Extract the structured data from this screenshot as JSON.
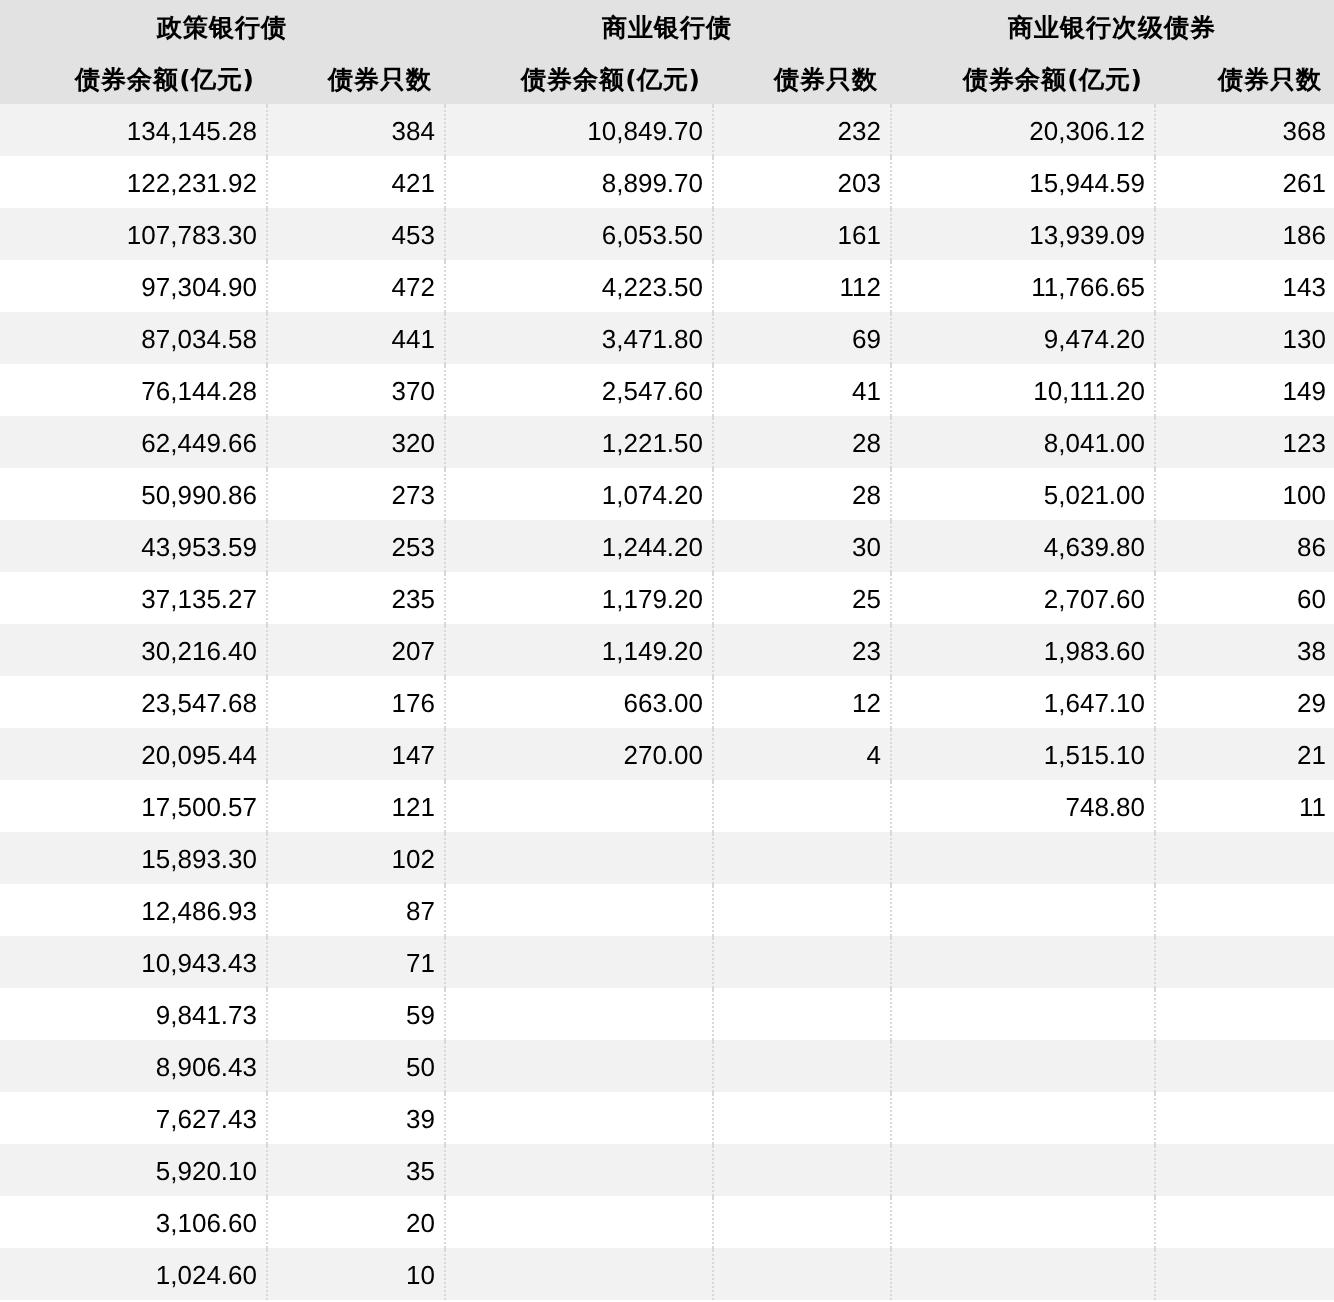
{
  "groups": [
    {
      "title": "政策银行债",
      "columns": [
        "债券余额(亿元)",
        "债券只数"
      ],
      "rows": [
        [
          "134,145.28",
          "384"
        ],
        [
          "122,231.92",
          "421"
        ],
        [
          "107,783.30",
          "453"
        ],
        [
          "97,304.90",
          "472"
        ],
        [
          "87,034.58",
          "441"
        ],
        [
          "76,144.28",
          "370"
        ],
        [
          "62,449.66",
          "320"
        ],
        [
          "50,990.86",
          "273"
        ],
        [
          "43,953.59",
          "253"
        ],
        [
          "37,135.27",
          "235"
        ],
        [
          "30,216.40",
          "207"
        ],
        [
          "23,547.68",
          "176"
        ],
        [
          "20,095.44",
          "147"
        ],
        [
          "17,500.57",
          "121"
        ],
        [
          "15,893.30",
          "102"
        ],
        [
          "12,486.93",
          "87"
        ],
        [
          "10,943.43",
          "71"
        ],
        [
          "9,841.73",
          "59"
        ],
        [
          "8,906.43",
          "50"
        ],
        [
          "7,627.43",
          "39"
        ],
        [
          "5,920.10",
          "35"
        ],
        [
          "3,106.60",
          "20"
        ],
        [
          "1,024.60",
          "10"
        ]
      ]
    },
    {
      "title": "商业银行债",
      "columns": [
        "债券余额(亿元)",
        "债券只数"
      ],
      "rows": [
        [
          "10,849.70",
          "232"
        ],
        [
          "8,899.70",
          "203"
        ],
        [
          "6,053.50",
          "161"
        ],
        [
          "4,223.50",
          "112"
        ],
        [
          "3,471.80",
          "69"
        ],
        [
          "2,547.60",
          "41"
        ],
        [
          "1,221.50",
          "28"
        ],
        [
          "1,074.20",
          "28"
        ],
        [
          "1,244.20",
          "30"
        ],
        [
          "1,179.20",
          "25"
        ],
        [
          "1,149.20",
          "23"
        ],
        [
          "663.00",
          "12"
        ],
        [
          "270.00",
          "4"
        ]
      ]
    },
    {
      "title": "商业银行次级债券",
      "columns": [
        "债券余额(亿元)",
        "债券只数"
      ],
      "rows": [
        [
          "20,306.12",
          "368"
        ],
        [
          "15,944.59",
          "261"
        ],
        [
          "13,939.09",
          "186"
        ],
        [
          "11,766.65",
          "143"
        ],
        [
          "9,474.20",
          "130"
        ],
        [
          "10,111.20",
          "149"
        ],
        [
          "8,041.00",
          "123"
        ],
        [
          "5,021.00",
          "100"
        ],
        [
          "4,639.80",
          "86"
        ],
        [
          "2,707.60",
          "60"
        ],
        [
          "1,983.60",
          "38"
        ],
        [
          "1,647.10",
          "29"
        ],
        [
          "1,515.10",
          "21"
        ],
        [
          "748.80",
          "11"
        ]
      ]
    }
  ]
}
